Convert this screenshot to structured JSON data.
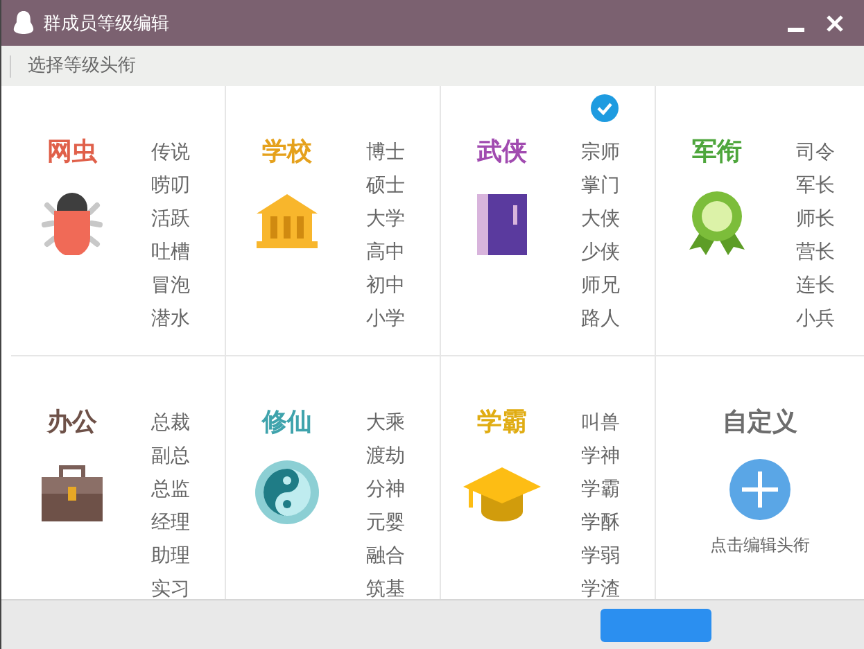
{
  "window": {
    "title": "群成员等级编辑"
  },
  "subtitle": "选择等级头衔",
  "categories": [
    {
      "kind": "bug",
      "title": "网虫",
      "color": "#e0604a",
      "selected": false,
      "levels": [
        "传说",
        "唠叨",
        "活跃",
        "吐槽",
        "冒泡",
        "潜水"
      ]
    },
    {
      "kind": "school",
      "title": "学校",
      "color": "#e5a11c",
      "selected": false,
      "levels": [
        "博士",
        "硕士",
        "大学",
        "高中",
        "初中",
        "小学"
      ]
    },
    {
      "kind": "book",
      "title": "武侠",
      "color": "#a14bb0",
      "selected": true,
      "levels": [
        "宗师",
        "掌门",
        "大侠",
        "少侠",
        "师兄",
        "路人"
      ]
    },
    {
      "kind": "medal",
      "title": "军衔",
      "color": "#4ea63c",
      "selected": false,
      "levels": [
        "司令",
        "军长",
        "师长",
        "营长",
        "连长",
        "小兵"
      ]
    },
    {
      "kind": "briefcase",
      "title": "办公",
      "color": "#6e5148",
      "selected": false,
      "levels": [
        "总裁",
        "副总",
        "总监",
        "经理",
        "助理",
        "实习"
      ]
    },
    {
      "kind": "yinyang",
      "title": "修仙",
      "color": "#3fa3ac",
      "selected": false,
      "levels": [
        "大乘",
        "渡劫",
        "分神",
        "元婴",
        "融合",
        "筑基"
      ]
    },
    {
      "kind": "cap",
      "title": "学霸",
      "color": "#e0ac12",
      "selected": false,
      "levels": [
        "叫兽",
        "学神",
        "学霸",
        "学酥",
        "学弱",
        "学渣"
      ]
    },
    {
      "kind": "custom",
      "title": "自定义",
      "color": "#6d6d6d",
      "selected": false,
      "caption": "点击编辑头衔"
    }
  ]
}
